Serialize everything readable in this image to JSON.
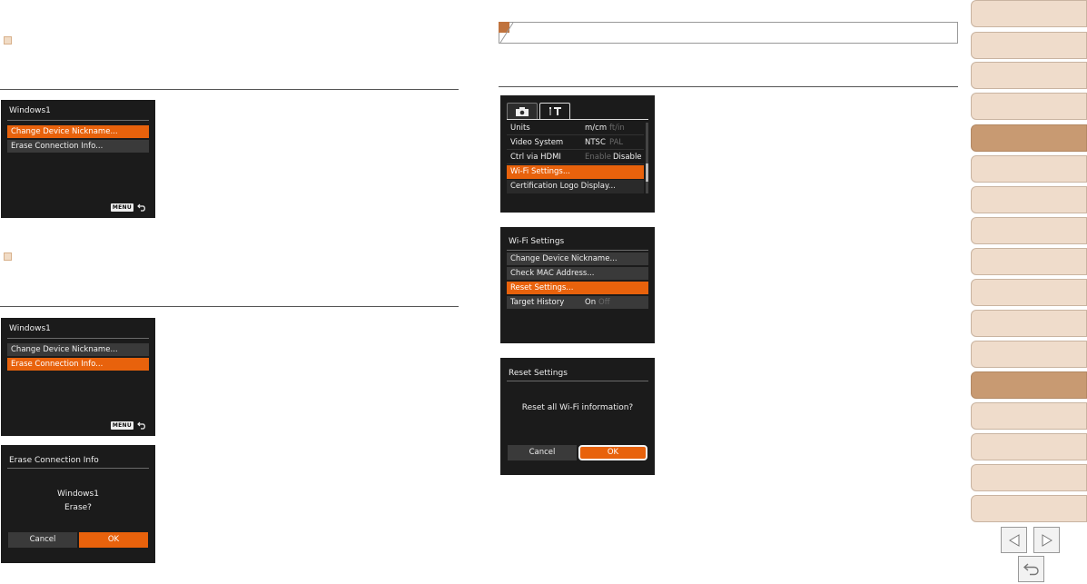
{
  "left_panel": {
    "screen1": {
      "title": "Windows1",
      "items": [
        {
          "label": "Change Device Nickname..."
        },
        {
          "label": "Erase Connection Info..."
        }
      ],
      "menu_badge": "MENU"
    },
    "screen2": {
      "title": "Windows1",
      "items": [
        {
          "label": "Change Device Nickname..."
        },
        {
          "label": "Erase Connection Info..."
        }
      ],
      "menu_badge": "MENU"
    },
    "screen3": {
      "title": "Erase Connection Info",
      "message_line1": "Windows1",
      "message_line2": "Erase?",
      "cancel": "Cancel",
      "ok": "OK"
    }
  },
  "right_panel": {
    "setup_menu": {
      "rows": [
        {
          "label": "Units",
          "opt1": "m/cm",
          "opt2": "ft/in"
        },
        {
          "label": "Video System",
          "opt1": "NTSC",
          "opt2": "PAL"
        },
        {
          "label": "Ctrl via HDMI",
          "opt1": "Enable",
          "opt2": "Disable"
        },
        {
          "label": "Wi-Fi Settings..."
        },
        {
          "label": "Certification Logo Display..."
        }
      ]
    },
    "wifi_settings": {
      "title": "Wi-Fi Settings",
      "items": [
        {
          "label": "Change Device Nickname..."
        },
        {
          "label": "Check MAC Address..."
        },
        {
          "label": "Reset Settings..."
        },
        {
          "label": "Target History",
          "opt1": "On",
          "opt2": "Off"
        }
      ]
    },
    "reset_settings": {
      "title": "Reset Settings",
      "message": "Reset all Wi-Fi information?",
      "cancel": "Cancel",
      "ok": "OK"
    }
  },
  "colors": {
    "highlight": "#e8620c",
    "nav_tab": "#efdccb",
    "nav_tab_active": "#c89a72",
    "section_square": "#f1dcc6"
  }
}
